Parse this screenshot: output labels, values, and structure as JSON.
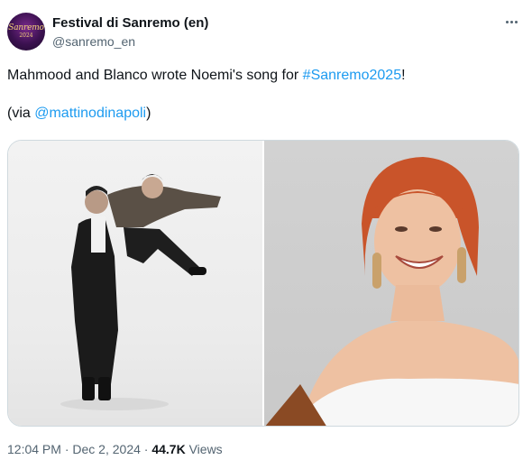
{
  "author": {
    "name": "Festival di Sanremo (en)",
    "handle": "@sanremo_en",
    "avatar_logo": "Sanremo",
    "avatar_year": "2024"
  },
  "tweet": {
    "text_before": "Mahmood and Blanco wrote Noemi's song for ",
    "hashtag": "#Sanremo2025",
    "text_after": "!",
    "via_prefix": "(via ",
    "mention": "@mattinodinapoli",
    "via_suffix": ")"
  },
  "meta": {
    "time": "12:04 PM",
    "separator": "·",
    "date": "Dec 2, 2024",
    "views_count": "44.7K",
    "views_label": "Views"
  },
  "colors": {
    "link": "#1d9bf0",
    "secondary_text": "#536471",
    "primary_text": "#0f1419",
    "border": "#cfd9de"
  },
  "icons": {
    "more": "more-horizontal-icon"
  }
}
